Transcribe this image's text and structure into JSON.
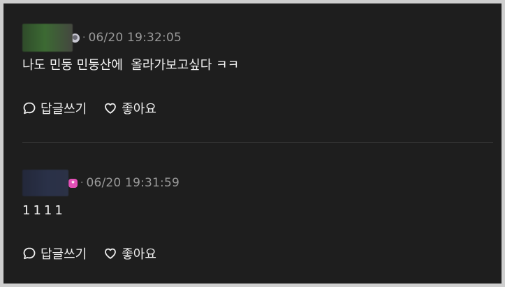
{
  "comments": [
    {
      "timestamp": "06/20 19:32:05",
      "separator": "·",
      "text": "나도 민둥 민둥산에  올라가보고싶다 ㅋㅋ",
      "reply_label": "답글쓰기",
      "like_label": "좋아요",
      "badge_icon": "gray-circle-badge-icon"
    },
    {
      "timestamp": "06/20 19:31:59",
      "separator": "·",
      "text": "1111",
      "reply_label": "답글쓰기",
      "like_label": "좋아요",
      "badge_icon": "pink-hexagon-badge-icon"
    }
  ],
  "colors": {
    "background": "#1e1e1e",
    "text": "#f2f2f2",
    "timestamp": "#9a9a9a",
    "divider": "#3e3e3e",
    "pink_badge": "#e24fb6"
  }
}
